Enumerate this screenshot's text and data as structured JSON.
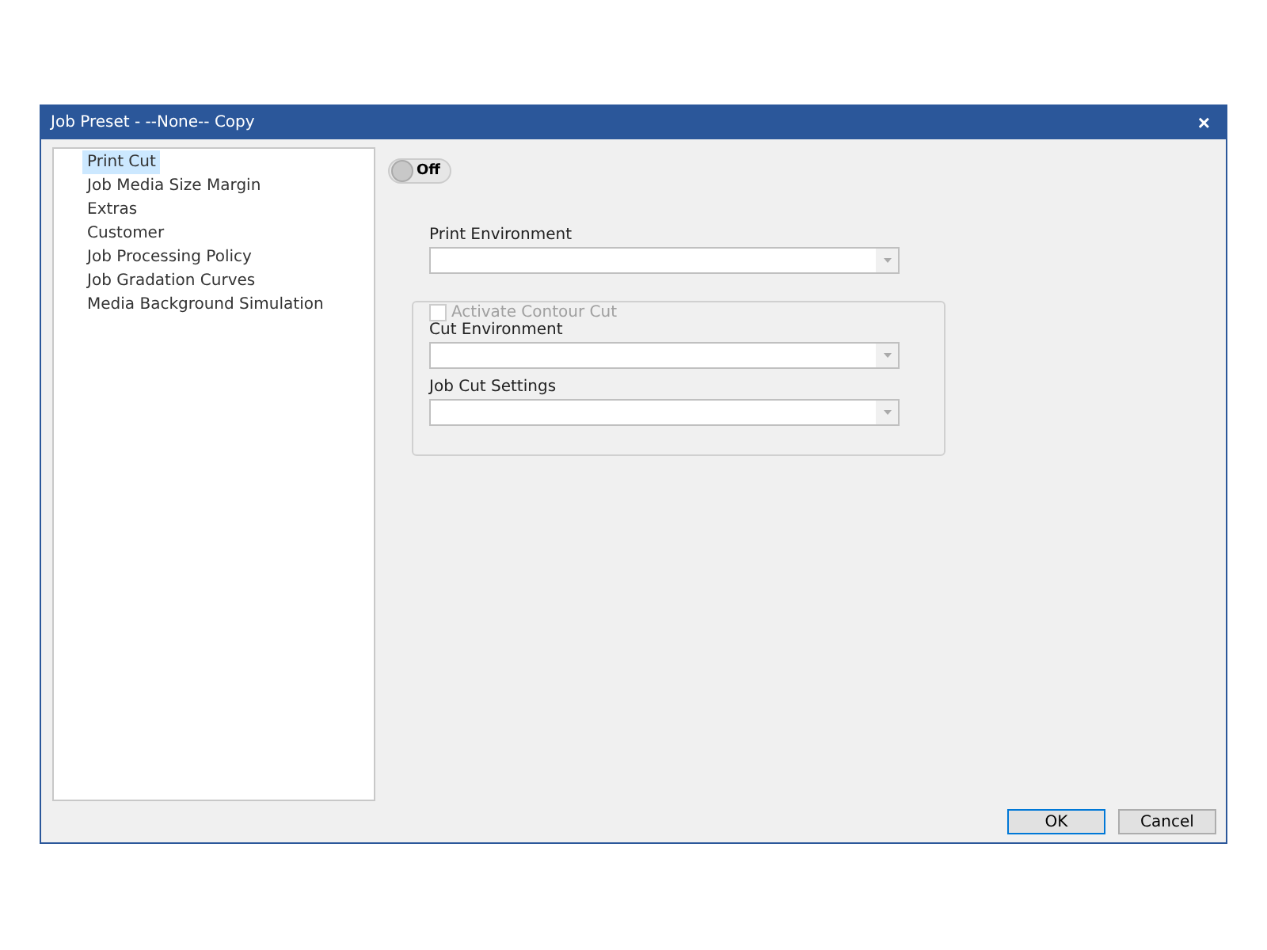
{
  "window": {
    "title": "Job Preset - --None-- Copy",
    "close": "×"
  },
  "sidebar": {
    "items": [
      {
        "label": "Print Cut",
        "selected": true
      },
      {
        "label": "Job Media Size Margin",
        "selected": false
      },
      {
        "label": "Extras",
        "selected": false
      },
      {
        "label": "Customer",
        "selected": false
      },
      {
        "label": "Job Processing Policy",
        "selected": false
      },
      {
        "label": "Job Gradation Curves",
        "selected": false
      },
      {
        "label": "Media Background Simulation",
        "selected": false
      }
    ]
  },
  "toggle": {
    "label": "Off",
    "on": false
  },
  "print_environment": {
    "label": "Print Environment"
  },
  "contour_group": {
    "checkbox": {
      "label": "Activate Contour Cut",
      "checked": false,
      "disabled": true
    },
    "fields": [
      {
        "label": "Cut Environment"
      },
      {
        "label": "Job Cut Settings"
      }
    ]
  },
  "buttons": [
    {
      "label": "OK",
      "default": true
    },
    {
      "label": "Cancel",
      "default": false
    }
  ]
}
